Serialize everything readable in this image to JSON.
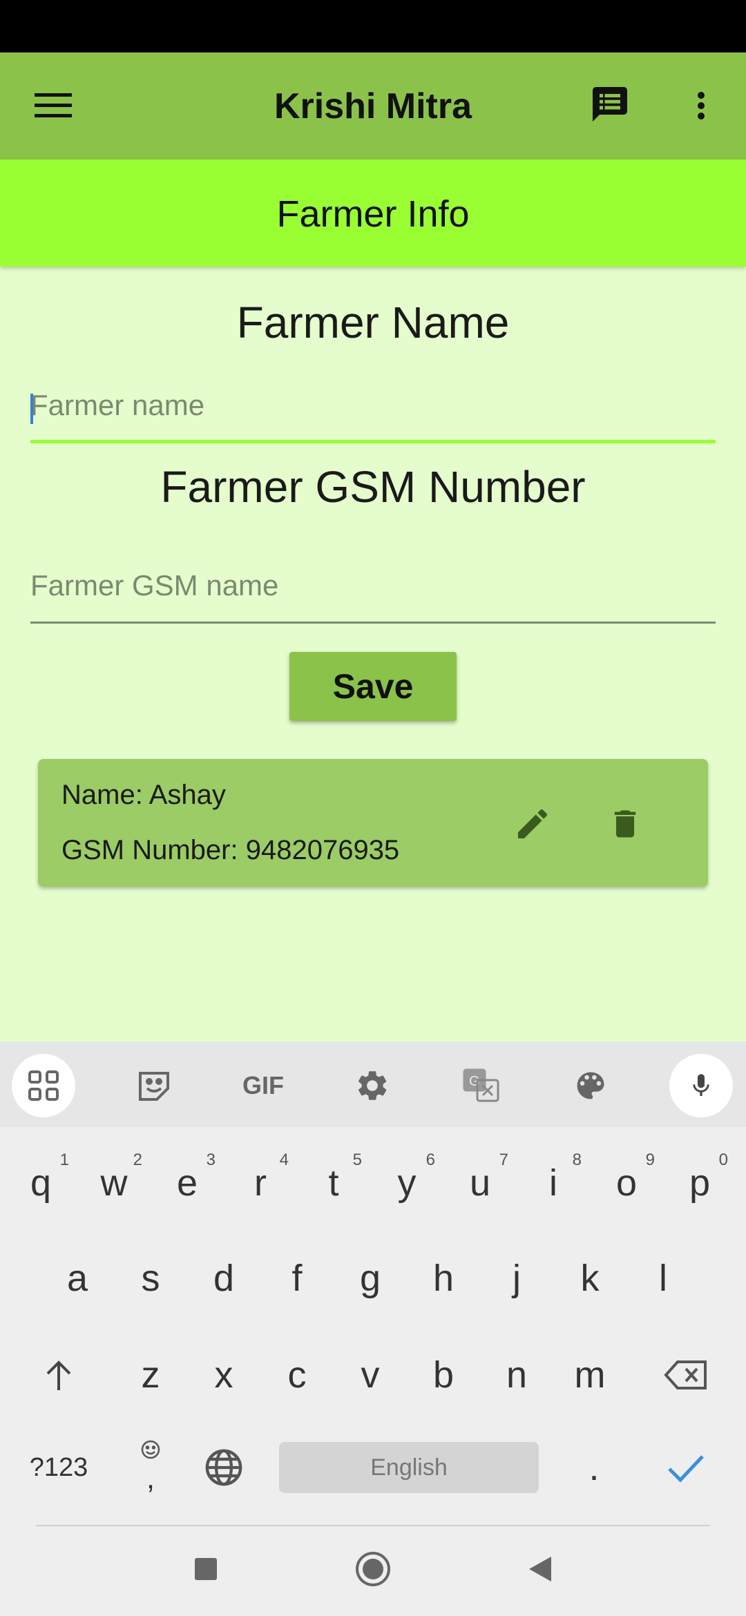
{
  "app": {
    "title": "Krishi Mitra"
  },
  "appbar": {
    "menu_icon": "hamburger-menu-icon",
    "chat_icon": "message-list-icon",
    "more_icon": "more-vertical-icon"
  },
  "subheader": {
    "title": "Farmer Info"
  },
  "form": {
    "name_heading": "Farmer Name",
    "name_placeholder": "Farmer name",
    "gsm_heading": "Farmer GSM Number",
    "gsm_placeholder": "Farmer GSM name",
    "save_label": "Save"
  },
  "farmers": [
    {
      "name_line": "Name: Ashay",
      "gsm_line": "GSM Number: 9482076935"
    }
  ],
  "keyboard": {
    "row1": [
      "q",
      "w",
      "e",
      "r",
      "t",
      "y",
      "u",
      "i",
      "o",
      "p"
    ],
    "row1_hints": [
      "1",
      "2",
      "3",
      "4",
      "5",
      "6",
      "7",
      "8",
      "9",
      "0"
    ],
    "row2": [
      "a",
      "s",
      "d",
      "f",
      "g",
      "h",
      "j",
      "k",
      "l"
    ],
    "row3": [
      "z",
      "x",
      "c",
      "v",
      "b",
      "n",
      "m"
    ],
    "symbols_label": "?123",
    "comma_label": ",",
    "period_label": ".",
    "space_label": "English",
    "gif_label": "GIF"
  },
  "colors": {
    "appbar": "#8bc34a",
    "subheader": "#99ff33",
    "background": "#e5fdcc",
    "card": "#9ccc65"
  }
}
